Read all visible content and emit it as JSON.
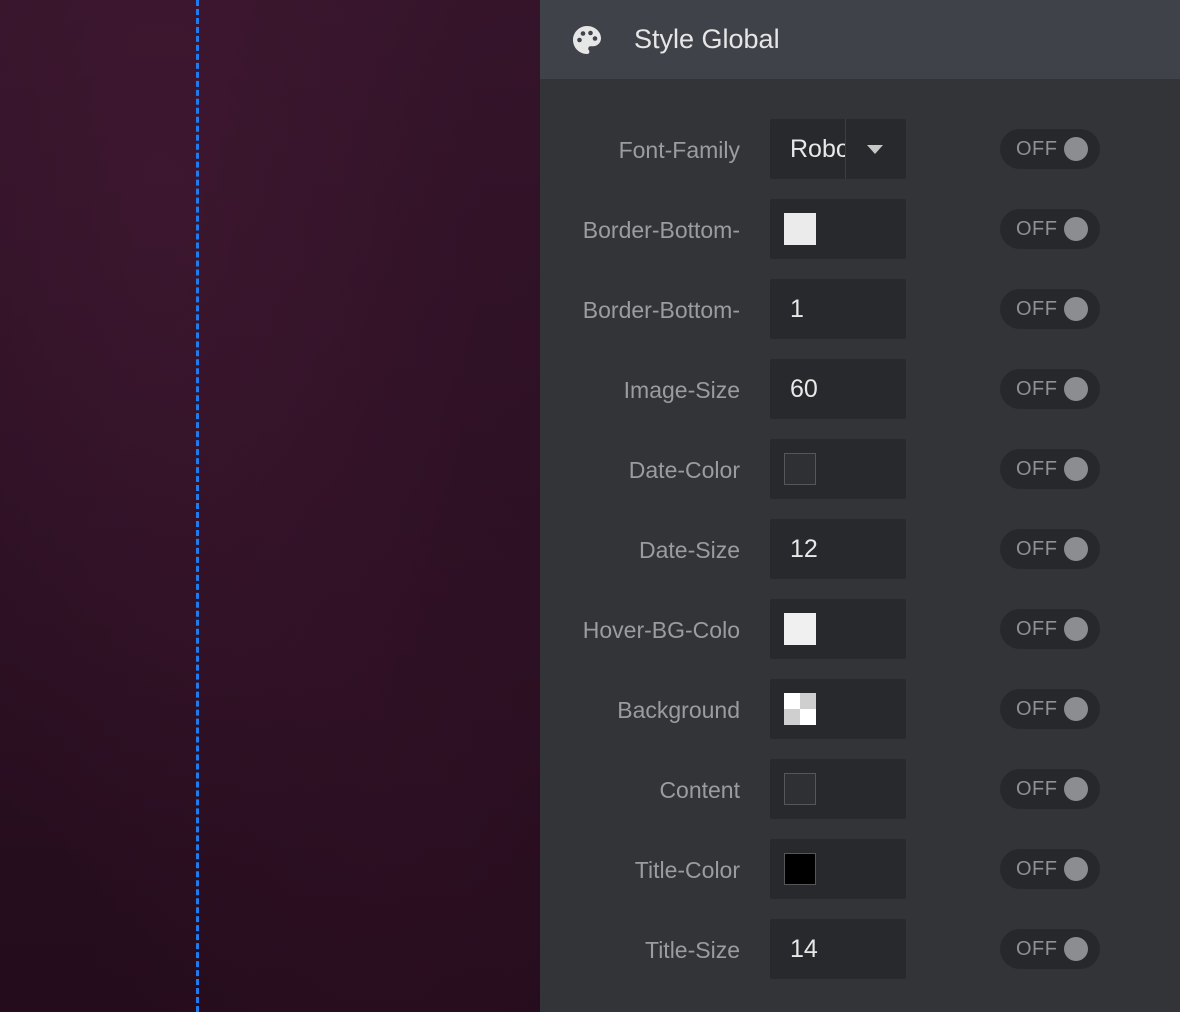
{
  "panel": {
    "title": "Style Global",
    "icon": "palette-icon"
  },
  "colors": {
    "guide_line": "#1e7bf0",
    "panel_bg": "#323438",
    "header_bg": "#3f4349",
    "field_bg": "#27292c"
  },
  "rows": [
    {
      "label": "Font-Family",
      "type": "select",
      "value": "Robo",
      "toggle": "OFF"
    },
    {
      "label": "Border-Bottom-",
      "type": "color",
      "swatch": "#ebebeb",
      "toggle": "OFF"
    },
    {
      "label": "Border-Bottom-",
      "type": "number",
      "value": "1",
      "toggle": "OFF"
    },
    {
      "label": "Image-Size",
      "type": "number",
      "value": "60",
      "toggle": "OFF"
    },
    {
      "label": "Date-Color",
      "type": "color",
      "swatch": "#2e3034",
      "toggle": "OFF"
    },
    {
      "label": "Date-Size",
      "type": "number",
      "value": "12",
      "toggle": "OFF"
    },
    {
      "label": "Hover-BG-Colo",
      "type": "color",
      "swatch": "#f0f0f0",
      "toggle": "OFF"
    },
    {
      "label": "Background",
      "type": "color",
      "swatch": "checker",
      "toggle": "OFF"
    },
    {
      "label": "Content",
      "type": "color",
      "swatch": "#2e3034",
      "toggle": "OFF"
    },
    {
      "label": "Title-Color",
      "type": "color",
      "swatch": "#000000",
      "toggle": "OFF"
    },
    {
      "label": "Title-Size",
      "type": "number",
      "value": "14",
      "toggle": "OFF"
    }
  ]
}
